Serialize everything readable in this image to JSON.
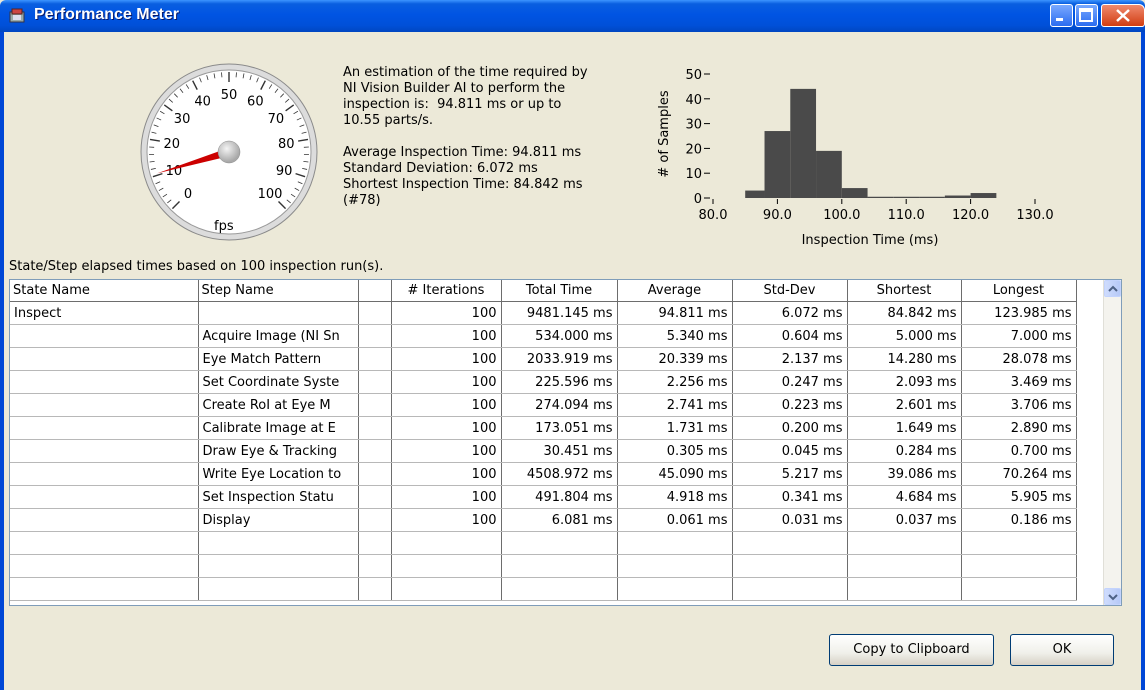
{
  "window": {
    "title": "Performance Meter"
  },
  "gauge": {
    "unit": "fps",
    "ticks": [
      "0",
      "10",
      "20",
      "30",
      "40",
      "50",
      "60",
      "70",
      "80",
      "90",
      "100"
    ],
    "needle_value": 10.55,
    "needle_color": "#cc0000"
  },
  "description": {
    "line1": "An estimation of the time required by",
    "line2": "NI Vision Builder AI to perform the",
    "line3": "inspection is:  94.811 ms or up to",
    "line4": "10.55 parts/s.",
    "average": "Average Inspection Time: 94.811 ms",
    "std_dev": "Standard Deviation: 6.072 ms",
    "shortest": "Shortest Inspection Time: 84.842 ms",
    "shortest_index": "(#78)"
  },
  "chart_data": {
    "type": "bar",
    "xlabel": "Inspection Time (ms)",
    "ylabel": "# of Samples",
    "xlim": [
      80.0,
      130.0
    ],
    "ylim": [
      0,
      50
    ],
    "xticks": [
      "80.0",
      "90.0",
      "100.0",
      "110.0",
      "120.0",
      "130.0"
    ],
    "yticks": [
      "0",
      "10",
      "20",
      "30",
      "40",
      "50"
    ],
    "bins": [
      {
        "start": 85,
        "end": 88,
        "count": 3
      },
      {
        "start": 88,
        "end": 92,
        "count": 27
      },
      {
        "start": 92,
        "end": 96,
        "count": 44
      },
      {
        "start": 96,
        "end": 100,
        "count": 19
      },
      {
        "start": 100,
        "end": 104,
        "count": 4
      },
      {
        "start": 104,
        "end": 108,
        "count": 0.5
      },
      {
        "start": 108,
        "end": 112,
        "count": 0.5
      },
      {
        "start": 112,
        "end": 116,
        "count": 0.5
      },
      {
        "start": 116,
        "end": 120,
        "count": 1
      },
      {
        "start": 120,
        "end": 124,
        "count": 2
      }
    ],
    "bar_color": "#4a4a4a"
  },
  "table_caption": "State/Step elapsed times based on 100 inspection run(s).",
  "table": {
    "headers": [
      "State Name",
      "Step Name",
      "",
      "# Iterations",
      "Total Time",
      "Average",
      "Std-Dev",
      "Shortest",
      "Longest"
    ],
    "rows": [
      [
        "Inspect",
        "",
        "",
        "100",
        "9481.145 ms",
        "94.811 ms",
        "6.072 ms",
        "84.842 ms",
        "123.985 ms"
      ],
      [
        "",
        "Acquire Image (NI Sn",
        "",
        "100",
        "534.000 ms",
        "5.340 ms",
        "0.604 ms",
        "5.000 ms",
        "7.000 ms"
      ],
      [
        "",
        "Eye Match Pattern",
        "",
        "100",
        "2033.919 ms",
        "20.339 ms",
        "2.137 ms",
        "14.280 ms",
        "28.078 ms"
      ],
      [
        "",
        "Set Coordinate Syste",
        "",
        "100",
        "225.596 ms",
        "2.256 ms",
        "0.247 ms",
        "2.093 ms",
        "3.469 ms"
      ],
      [
        "",
        "Create RoI at Eye M",
        "",
        "100",
        "274.094 ms",
        "2.741 ms",
        "0.223 ms",
        "2.601 ms",
        "3.706 ms"
      ],
      [
        "",
        "Calibrate Image at E",
        "",
        "100",
        "173.051 ms",
        "1.731 ms",
        "0.200 ms",
        "1.649 ms",
        "2.890 ms"
      ],
      [
        "",
        "Draw Eye & Tracking",
        "",
        "100",
        "30.451 ms",
        "0.305 ms",
        "0.045 ms",
        "0.284 ms",
        "0.700 ms"
      ],
      [
        "",
        "Write Eye Location to",
        "",
        "100",
        "4508.972 ms",
        "45.090 ms",
        "5.217 ms",
        "39.086 ms",
        "70.264 ms"
      ],
      [
        "",
        "Set Inspection Statu",
        "",
        "100",
        "491.804 ms",
        "4.918 ms",
        "0.341 ms",
        "4.684 ms",
        "5.905 ms"
      ],
      [
        "",
        "Display",
        "",
        "100",
        "6.081 ms",
        "0.061 ms",
        "0.031 ms",
        "0.037 ms",
        "0.186 ms"
      ],
      [
        "",
        "",
        "",
        "",
        "",
        "",
        "",
        "",
        ""
      ],
      [
        "",
        "",
        "",
        "",
        "",
        "",
        "",
        "",
        ""
      ],
      [
        "",
        "",
        "",
        "",
        "",
        "",
        "",
        "",
        ""
      ]
    ]
  },
  "buttons": {
    "copy": "Copy to Clipboard",
    "ok": "OK"
  }
}
